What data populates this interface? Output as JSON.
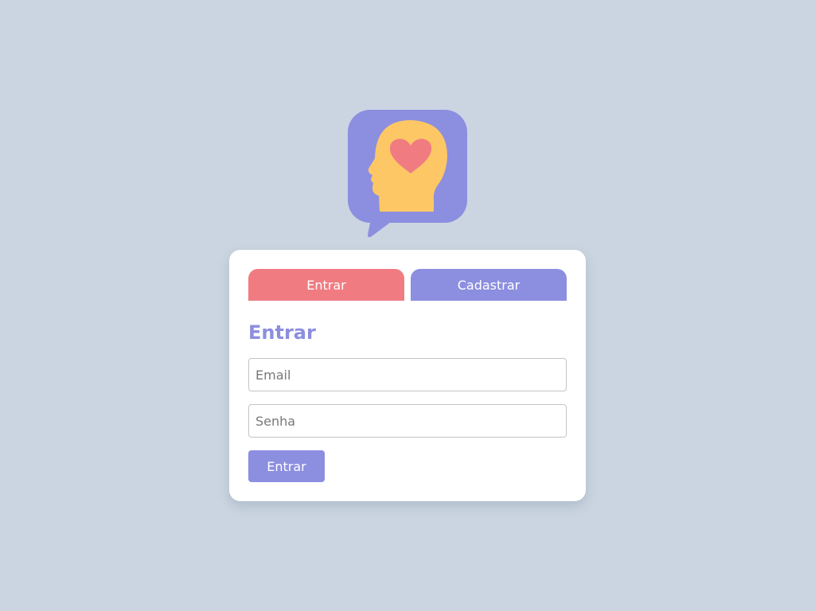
{
  "logo": {
    "icon": "mind-heart-chat-icon"
  },
  "tabs": [
    {
      "label": "Entrar",
      "active": true
    },
    {
      "label": "Cadastrar",
      "active": false
    }
  ],
  "form": {
    "title": "Entrar",
    "email_placeholder": "Email",
    "password_placeholder": "Senha",
    "submit_label": "Entrar"
  },
  "colors": {
    "background": "#cbd5e1",
    "primary": "#8c8ee0",
    "accent": "#f07c82",
    "head": "#fdc765"
  }
}
